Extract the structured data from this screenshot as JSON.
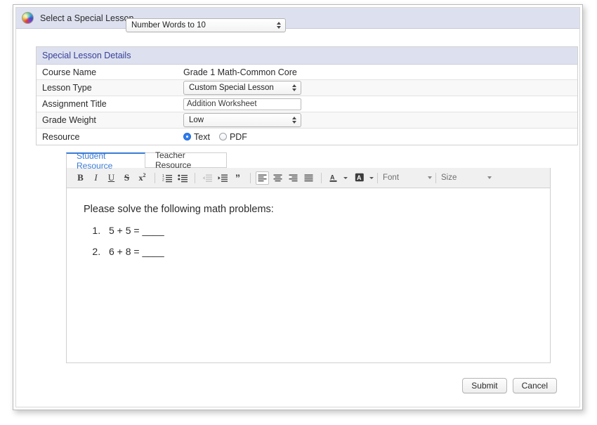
{
  "top_bar": {
    "icon": "rainbow-orb-icon",
    "label": "Select a Special Lesson",
    "lesson_select": {
      "value": "Number Words to 10",
      "options": [
        "Number Words to 10"
      ]
    }
  },
  "details": {
    "header": "Special Lesson Details",
    "rows": [
      {
        "label": "Course Name",
        "value": "Grade 1 Math-Common Core",
        "type": "text"
      },
      {
        "label": "Lesson Type",
        "value": "Custom Special Lesson",
        "type": "select"
      },
      {
        "label": "Assignment Title",
        "value": "Addition Worksheet",
        "placeholder": "",
        "type": "input"
      },
      {
        "label": "Grade Weight",
        "value": "Low",
        "type": "select"
      },
      {
        "label": "Resource",
        "value": "Text",
        "type": "radio"
      }
    ],
    "resource_options": [
      {
        "label": "Text",
        "checked": true
      },
      {
        "label": "PDF",
        "checked": false
      }
    ]
  },
  "editor": {
    "tabs": [
      {
        "label": "Student Resource",
        "active": true
      },
      {
        "label": "Teacher Resource",
        "active": false
      }
    ],
    "toolbar": {
      "buttons": [
        {
          "name": "bold-icon",
          "glyph": "B",
          "state": "normal"
        },
        {
          "name": "italic-icon",
          "glyph": "I",
          "state": "normal"
        },
        {
          "name": "underline-icon",
          "glyph": "U",
          "state": "normal"
        },
        {
          "name": "strikethrough-icon",
          "glyph": "S",
          "state": "normal"
        },
        {
          "name": "superscript-icon",
          "glyph": "x²",
          "state": "normal"
        },
        {
          "name": "ordered-list-icon",
          "glyph": "",
          "state": "normal"
        },
        {
          "name": "unordered-list-icon",
          "glyph": "",
          "state": "normal"
        },
        {
          "name": "outdent-icon",
          "glyph": "",
          "state": "disabled"
        },
        {
          "name": "indent-icon",
          "glyph": "",
          "state": "normal"
        },
        {
          "name": "blockquote-icon",
          "glyph": "”",
          "state": "normal"
        },
        {
          "name": "align-left-icon",
          "glyph": "",
          "state": "pressed"
        },
        {
          "name": "align-center-icon",
          "glyph": "",
          "state": "normal"
        },
        {
          "name": "align-right-icon",
          "glyph": "",
          "state": "normal"
        },
        {
          "name": "align-justify-icon",
          "glyph": "",
          "state": "normal"
        },
        {
          "name": "text-color-icon",
          "glyph": "A",
          "state": "normal"
        },
        {
          "name": "highlight-color-icon",
          "glyph": "A",
          "state": "normal"
        }
      ],
      "font_label": "Font",
      "size_label": "Size"
    },
    "content": {
      "intro": "Please solve the following math problems:",
      "problems": [
        "5 + 5 = ____",
        "6 + 8 = ____"
      ]
    }
  },
  "footer": {
    "submit_label": "Submit",
    "cancel_label": "Cancel"
  },
  "colors": {
    "header_bg": "#dde1ef",
    "header_text": "#37409a",
    "tab_active": "#3a7bd5",
    "radio_checked": "#2f7ef0"
  }
}
